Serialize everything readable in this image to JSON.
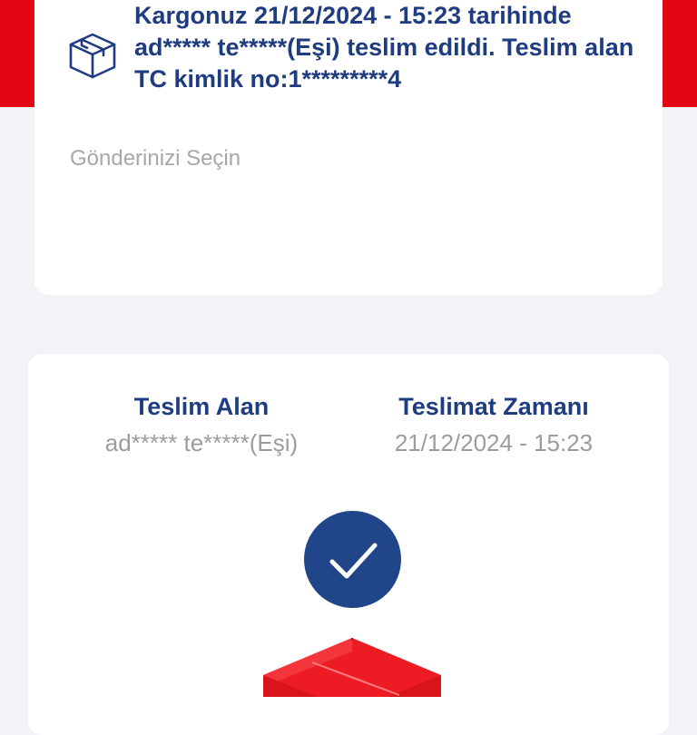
{
  "status": {
    "message": "Kargonuz 21/12/2024 - 15:23 tarihinde ad***** te*****(Eşi) teslim edildi. Teslim alan TC kimlik no:1*********4",
    "icon": "package-box-icon"
  },
  "shipment_select": {
    "placeholder": "Gönderinizi Seçin"
  },
  "delivery": {
    "receiver_label": "Teslim Alan",
    "receiver_value": "ad***** te*****(Eşi)",
    "time_label": "Teslimat Zamanı",
    "time_value": "21/12/2024 - 15:23",
    "status_icon": "checkmark-icon",
    "illustration_icon": "red-package-icon"
  },
  "colors": {
    "brand_red": "#e30613",
    "brand_navy": "#1e3c7f",
    "check_navy": "#214589",
    "muted_gray": "#9b9ca0",
    "background": "#f2f3f7"
  }
}
